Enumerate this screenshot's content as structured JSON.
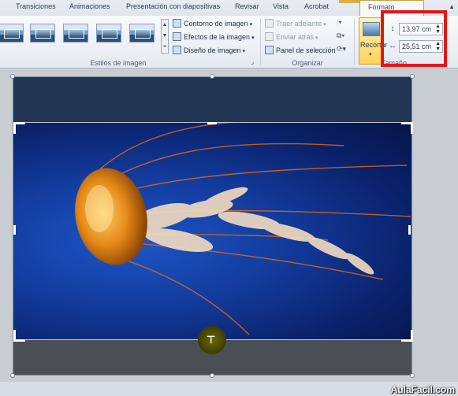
{
  "tabs": [
    {
      "label": "Transiciones"
    },
    {
      "label": "Animaciones"
    },
    {
      "label": "Presentación con diapositivas"
    },
    {
      "label": "Revisar"
    },
    {
      "label": "Vista"
    },
    {
      "label": "Acrobat"
    },
    {
      "label": "Formato",
      "active": true
    }
  ],
  "ribbon": {
    "styles_group": {
      "label": "Estilos de imagen",
      "commands": {
        "border": "Contorno de imagen",
        "effects": "Efectos de la imagen",
        "layout": "Diseño de imagen"
      }
    },
    "arrange_group": {
      "label": "Organizar",
      "commands": {
        "bring_forward": "Traer adelante",
        "send_backward": "Enviar atrás",
        "selection_pane": "Panel de selección"
      }
    },
    "size_group": {
      "label": "Tamaño",
      "crop_label": "Recortar",
      "height_value": "13,97 cm",
      "width_value": "25,51 cm"
    }
  },
  "icons": [
    "crop-icon",
    "height-icon",
    "width-icon",
    "crop-cursor-icon"
  ],
  "colors": {
    "highlight": "#e01818",
    "accent": "#d8b04a"
  },
  "watermark": "AulaFacil.com"
}
